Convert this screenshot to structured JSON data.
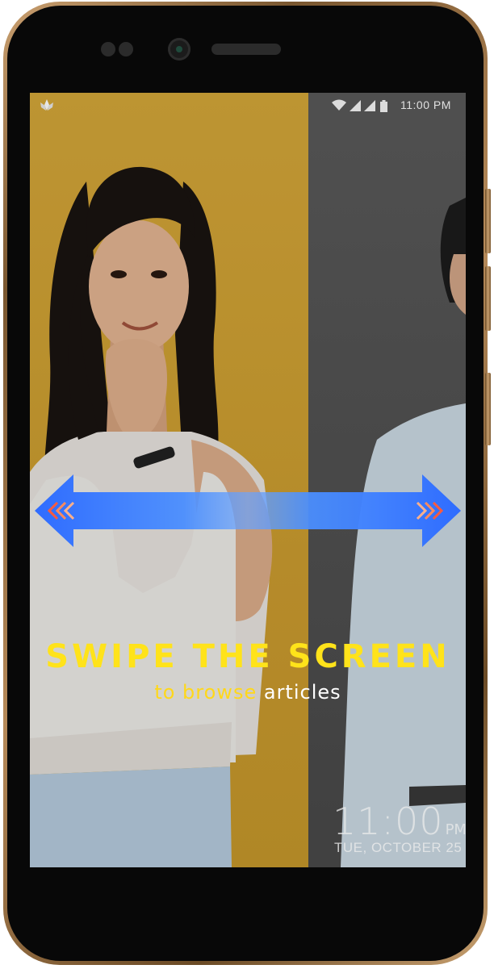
{
  "status_bar": {
    "time": "11:00 PM",
    "icons": [
      "app-logo-icon",
      "wifi-icon",
      "signal-icon",
      "signal-icon",
      "battery-icon"
    ]
  },
  "headline": "SWIPE THE SCREEN",
  "subline": {
    "part1": "to browse",
    "part2": "articles"
  },
  "lock_clock": {
    "time": "11:00",
    "ampm": "PM",
    "date": "TUE, OCTOBER 25"
  },
  "colors": {
    "headline": "#ffe31a",
    "subline_accent": "#ffd81a",
    "arrow": "#3e86ff",
    "left_panel": "#d8aa3a",
    "right_panel": "#555555",
    "phone_frame": "#a07a48"
  }
}
